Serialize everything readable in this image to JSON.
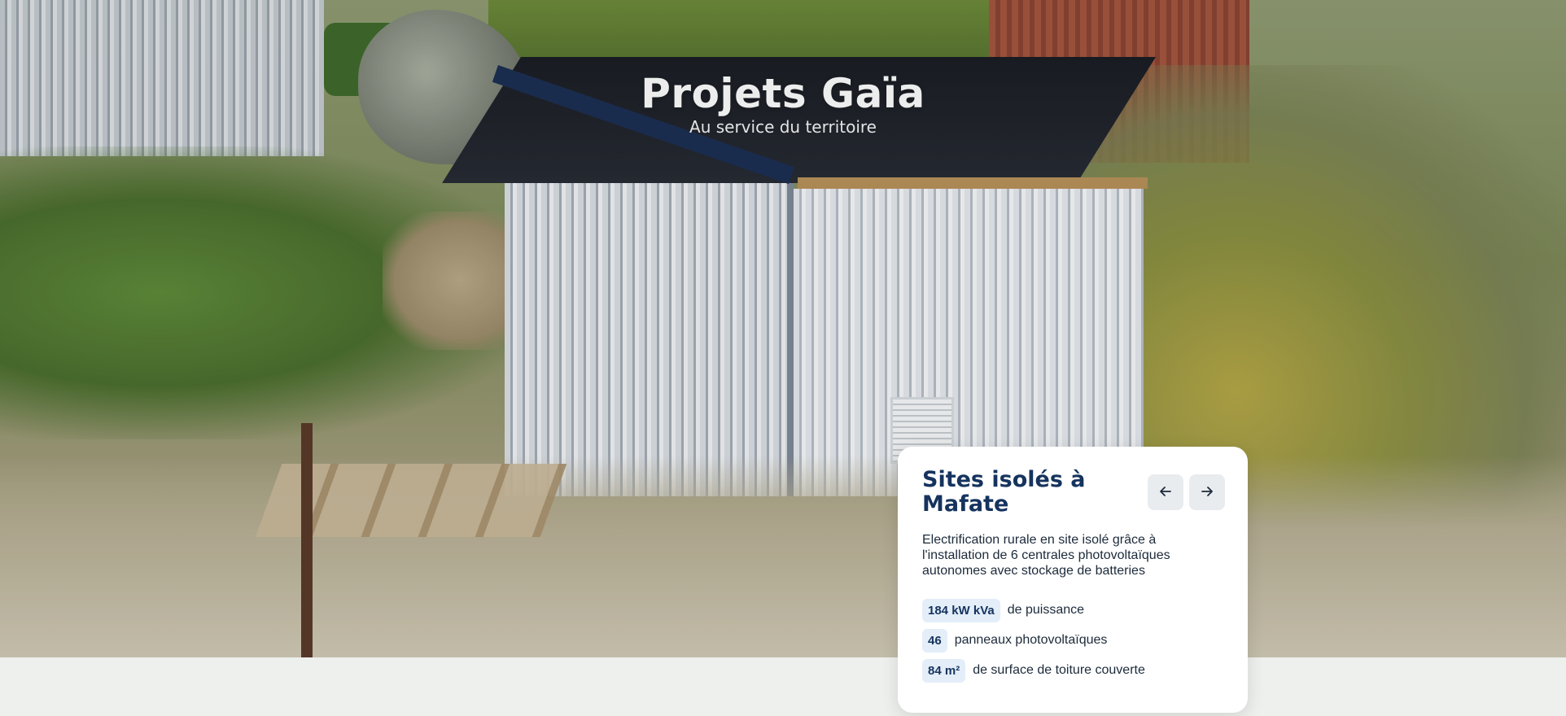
{
  "hero": {
    "title": "Projets Gaïa",
    "subtitle": "Au service du territoire"
  },
  "card": {
    "title": "Sites isolés à Mafate",
    "description": "Electrification rurale en site isolé grâce à l'installation de 6 centrales photovoltaïques autonomes avec stockage de batteries",
    "nav": {
      "prev_icon": "arrow-left-icon",
      "next_icon": "arrow-right-icon"
    },
    "stats": [
      {
        "value": "184 kW kVa",
        "label": "de puissance"
      },
      {
        "value": "46",
        "label": "panneaux photovoltaïques"
      },
      {
        "value": "84 m²",
        "label": "de surface de toiture couverte"
      }
    ]
  },
  "colors": {
    "title": "#15335e",
    "badge_bg": "#e3eef9",
    "page_bg": "#eef0ee",
    "card_bg": "#ffffff"
  }
}
